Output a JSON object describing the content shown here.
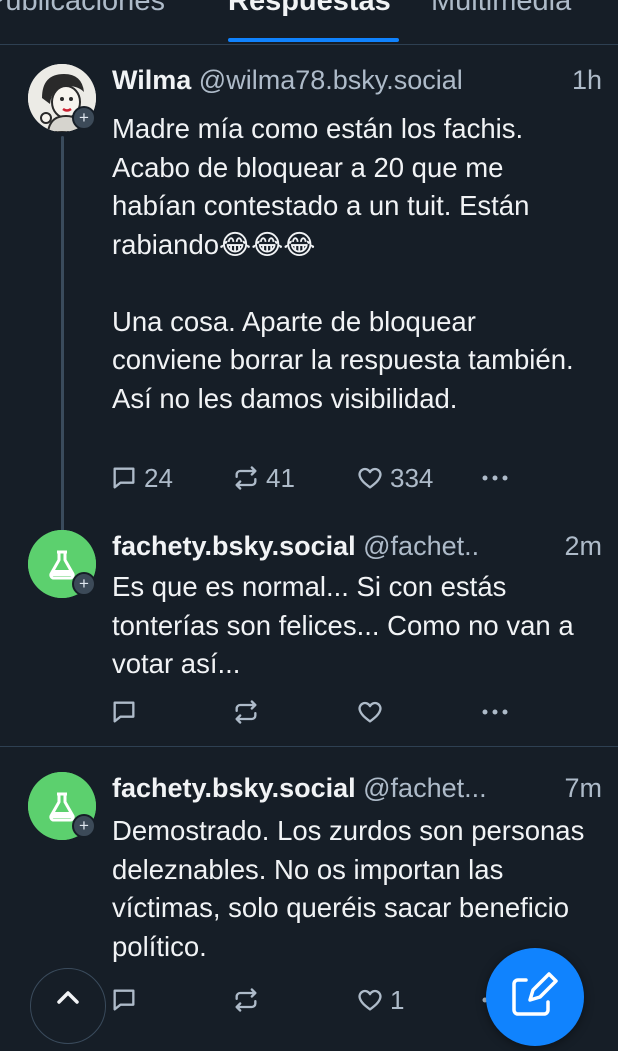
{
  "tabs": [
    {
      "label": "Publicaciones"
    },
    {
      "label": "Respuestas"
    },
    {
      "label": "Multimedia"
    }
  ],
  "posts": [
    {
      "name": "Wilma",
      "handle": "@wilma78.bsky.social",
      "time": "1h",
      "paragraphs": [
        "Madre mía como están los fachis. Acabo de bloquear a 20 que me habían contestado a un tuit. Están rabiando😂😂😂",
        "Una cosa. Aparte de bloquear conviene borrar la respuesta también. Así no les damos visibilidad."
      ],
      "replies": "24",
      "reposts": "41",
      "likes": "334"
    },
    {
      "name": "fachety.bsky.social",
      "handle": "@fachet..",
      "time": "2m",
      "paragraphs": [
        "Es que es normal... Si con estás tonterías son felices... Como no van a votar así..."
      ],
      "replies": "",
      "reposts": "",
      "likes": ""
    },
    {
      "name": "fachety.bsky.social",
      "handle": "@fachet...",
      "time": "7m",
      "paragraphs": [
        "Demostrado. Los zurdos son personas deleznables. No os importan las víctimas, solo queréis sacar beneficio político."
      ],
      "replies": "",
      "reposts": "",
      "likes": "1"
    }
  ],
  "colors": {
    "background": "#161e27",
    "accent": "#1083fe",
    "secondary_text": "#aebbc9",
    "default_avatar": "#5cd06e"
  },
  "icons": {
    "reply": "speech-bubble-icon",
    "repost": "repost-arrows-icon",
    "like": "heart-icon",
    "more": "ellipsis-icon",
    "compose": "pencil-icon",
    "scroll_top": "chevron-up-icon",
    "follow": "plus-icon"
  }
}
